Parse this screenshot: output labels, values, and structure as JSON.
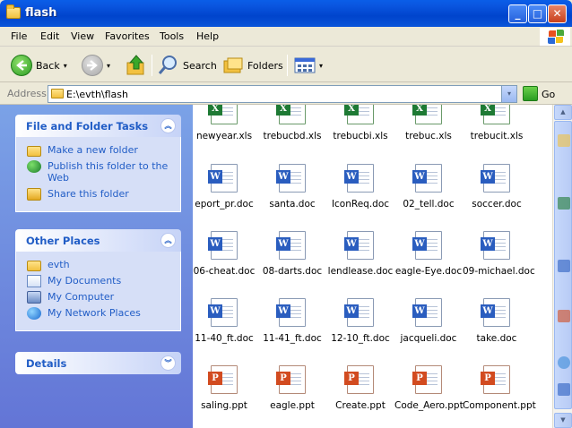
{
  "window": {
    "title": "flash",
    "min_glyph": "_",
    "max_glyph": "□",
    "close_glyph": "✕"
  },
  "menu": [
    "File",
    "Edit",
    "View",
    "Favorites",
    "Tools",
    "Help"
  ],
  "toolbar": {
    "back_label": "Back",
    "search_label": "Search",
    "folders_label": "Folders",
    "dd_glyph": "▾"
  },
  "address": {
    "label": "Address",
    "value": "E:\\evth\\flash",
    "go_label": "Go",
    "dd_glyph": "▾"
  },
  "left_pane": {
    "file_folder_tasks": {
      "title": "File and Folder Tasks",
      "chevron": "︽",
      "items": [
        "Make a new folder",
        "Publish this folder to the Web",
        "Share this folder"
      ]
    },
    "other_places": {
      "title": "Other Places",
      "chevron": "︽",
      "items": [
        "evth",
        "My Documents",
        "My Computer",
        "My Network Places"
      ]
    },
    "details": {
      "title": "Details",
      "chevron": "︾"
    }
  },
  "files": [
    {
      "name": "newyear.xls",
      "type": "xls",
      "badge": "X"
    },
    {
      "name": "trebucbd.xls",
      "type": "xls",
      "badge": "X"
    },
    {
      "name": "trebucbi.xls",
      "type": "xls",
      "badge": "X"
    },
    {
      "name": "trebuc.xls",
      "type": "xls",
      "badge": "X"
    },
    {
      "name": "trebucit.xls",
      "type": "xls",
      "badge": "X"
    },
    {
      "name": "eport_pr.doc",
      "type": "doc",
      "badge": "W"
    },
    {
      "name": "santa.doc",
      "type": "doc",
      "badge": "W"
    },
    {
      "name": "IconReq.doc",
      "type": "doc",
      "badge": "W"
    },
    {
      "name": "02_tell.doc",
      "type": "doc",
      "badge": "W"
    },
    {
      "name": "soccer.doc",
      "type": "doc",
      "badge": "W"
    },
    {
      "name": "06-cheat.doc",
      "type": "doc",
      "badge": "W"
    },
    {
      "name": "08-darts.doc",
      "type": "doc",
      "badge": "W"
    },
    {
      "name": "lendlease.doc",
      "type": "doc",
      "badge": "W"
    },
    {
      "name": "eagle-Eye.doc",
      "type": "doc",
      "badge": "W"
    },
    {
      "name": "09-michael.doc",
      "type": "doc",
      "badge": "W"
    },
    {
      "name": "11-40_ft.doc",
      "type": "doc",
      "badge": "W"
    },
    {
      "name": "11-41_ft.doc",
      "type": "doc",
      "badge": "W"
    },
    {
      "name": "12-10_ft.doc",
      "type": "doc",
      "badge": "W"
    },
    {
      "name": "jacqueli.doc",
      "type": "doc",
      "badge": "W"
    },
    {
      "name": "take.doc",
      "type": "doc",
      "badge": "W"
    },
    {
      "name": "saling.ppt",
      "type": "ppt",
      "badge": "P"
    },
    {
      "name": "eagle.ppt",
      "type": "ppt",
      "badge": "P"
    },
    {
      "name": "Create.ppt",
      "type": "ppt",
      "badge": "P"
    },
    {
      "name": "Code_Aero.ppt",
      "type": "ppt",
      "badge": "P"
    },
    {
      "name": "Component.ppt",
      "type": "ppt",
      "badge": "P"
    }
  ],
  "scrollbar": {
    "up_glyph": "▲",
    "down_glyph": "▼"
  }
}
